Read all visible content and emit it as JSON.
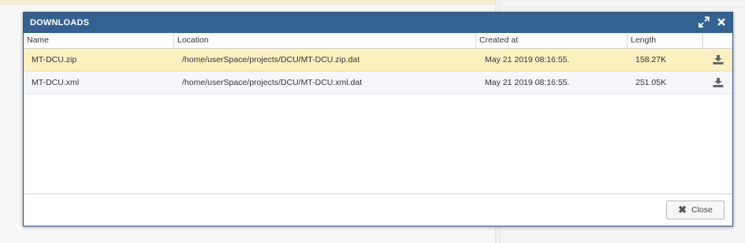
{
  "dialog": {
    "title": "DOWNLOADS",
    "maximize_icon": "expand-arrows",
    "close_icon": "close-x"
  },
  "table": {
    "columns": [
      "Name",
      "Location",
      "Created at",
      "Length",
      ""
    ],
    "rows": [
      {
        "name": "MT-DCU.zip",
        "location": "/home/userSpace/projects/DCU/MT-DCU.zip.dat",
        "created": "May 21 2019 08:16:55.",
        "length": "158.27K",
        "selected": true
      },
      {
        "name": "MT-DCU.xml",
        "location": "/home/userSpace/projects/DCU/MT-DCU.xml.dat",
        "created": "May 21 2019 08:16:55.",
        "length": "251.05K",
        "selected": false
      }
    ]
  },
  "footer": {
    "close_label": "Close"
  },
  "colors": {
    "header": "#34618f",
    "selected_row": "#fcefc0"
  }
}
